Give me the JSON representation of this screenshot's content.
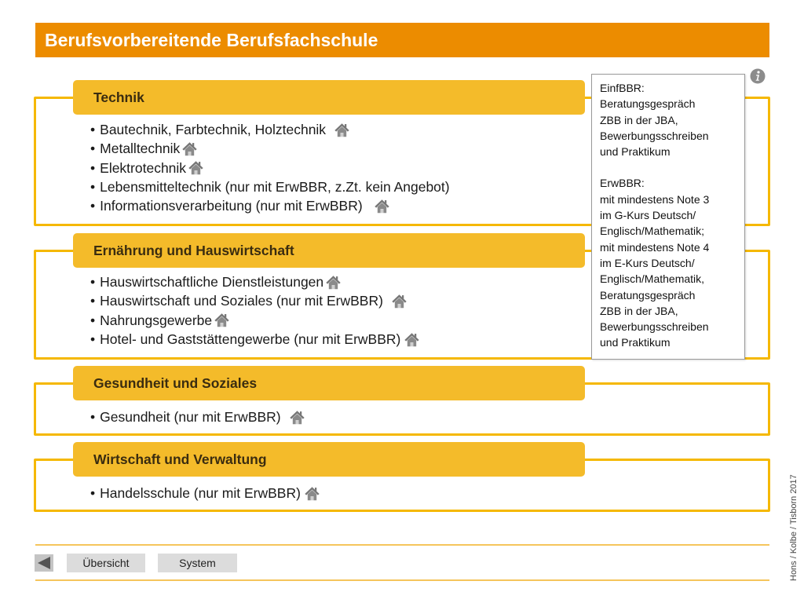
{
  "title": "Berufsvorbereitende Berufsfachschule",
  "sections": [
    {
      "header": "Technik",
      "items": [
        "Bautechnik, Farbtechnik, Holztechnik",
        "Metalltechnik",
        "Elektrotechnik",
        "Lebensmitteltechnik (nur mit ErwBBR, z.Zt. kein Angebot)",
        "Informationsverarbeitung (nur mit ErwBBR)"
      ]
    },
    {
      "header": "Ernährung und Hauswirtschaft",
      "items": [
        "Hauswirtschaftliche Dienstleistungen",
        "Hauswirtschaft und Soziales (nur mit ErwBBR)",
        "Nahrungsgewerbe",
        "Hotel- und Gaststättengewerbe (nur mit ErwBBR)"
      ]
    },
    {
      "header": "Gesundheit und Soziales",
      "items": [
        "Gesundheit (nur mit ErwBBR)"
      ]
    },
    {
      "header": "Wirtschaft und Verwaltung",
      "items": [
        "Handelsschule (nur mit ErwBBR)"
      ]
    }
  ],
  "info_box": {
    "einf_title": "EinfBBR:",
    "einf_lines": [
      "Beratungsgespräch",
      "ZBB in der JBA,",
      "Bewerbungsschreiben",
      "und Praktikum"
    ],
    "erw_title": "ErwBBR:",
    "erw_lines": [
      "mit mindestens Note 3",
      "im G-Kurs Deutsch/",
      "Englisch/Mathematik;",
      "mit mindestens Note 4",
      "im E-Kurs Deutsch/",
      "Englisch/Mathematik,",
      "Beratungsgespräch",
      "ZBB in der JBA,",
      "Bewerbungsschreiben",
      "und Praktikum"
    ]
  },
  "icons": {
    "home": "home-icon",
    "info": "info-icon",
    "back": "back-arrow-icon"
  },
  "footer": {
    "overview_label": "Übersicht",
    "system_label": "System"
  },
  "credit": "Hons / Kolbe / Tisborn 2017",
  "colors": {
    "title_bar": "#ec8c00",
    "section_header": "#f4bb2a",
    "frame_border": "#f5b800",
    "home_icon": "#7a7a7a"
  }
}
